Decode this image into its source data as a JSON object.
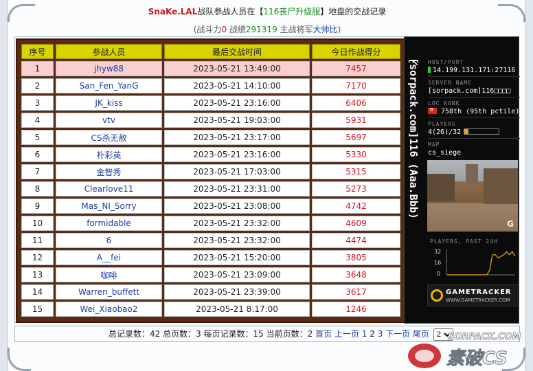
{
  "header": {
    "team": "SnaKe.LAL",
    "text1": "战队参战人员在【",
    "server": "116丧尸升级服",
    "text2": "】地盘的交战记录"
  },
  "stats": {
    "open": "(战斗力",
    "power": "0",
    "label_record": " 战绩",
    "record": "291319",
    "label_leader": " 主战将军",
    "leader": "大帅比",
    "close": ")"
  },
  "table": {
    "headers": [
      "序号",
      "参战人员",
      "最后交战时间",
      "今日作战得分"
    ],
    "rows": [
      {
        "no": "1",
        "name": "jhyw88",
        "time": "2023-05-21 13:49:00",
        "score": "7457"
      },
      {
        "no": "2",
        "name": "San_Fen_YanG",
        "time": "2023-05-21 14:10:00",
        "score": "7170"
      },
      {
        "no": "3",
        "name": "JK_kiss",
        "time": "2023-05-21 23:16:00",
        "score": "6406"
      },
      {
        "no": "4",
        "name": "vtv",
        "time": "2023-05-21 19:03:00",
        "score": "5931"
      },
      {
        "no": "5",
        "name": "CS杀无赦",
        "time": "2023-05-21 23:17:00",
        "score": "5697"
      },
      {
        "no": "6",
        "name": "朴彩英",
        "time": "2023-05-21 23:16:00",
        "score": "5330"
      },
      {
        "no": "7",
        "name": "金智秀",
        "time": "2023-05-21 17:03:00",
        "score": "5315"
      },
      {
        "no": "8",
        "name": "Clearlove11",
        "time": "2023-05-21 23:31:00",
        "score": "5273"
      },
      {
        "no": "9",
        "name": "Mas_NI_Sorry",
        "time": "2023-05-21 23:08:00",
        "score": "4742"
      },
      {
        "no": "10",
        "name": "formidable",
        "time": "2023-05-21 23:32:00",
        "score": "4609"
      },
      {
        "no": "11",
        "name": "6",
        "time": "2023-05-21 23:32:00",
        "score": "4474"
      },
      {
        "no": "12",
        "name": "A__fei",
        "time": "2023-05-21 15:20:00",
        "score": "3805"
      },
      {
        "no": "13",
        "name": "咖啡",
        "time": "2023-05-21 23:09:00",
        "score": "3648"
      },
      {
        "no": "14",
        "name": "Warren_buffett",
        "time": "2023-05-21 23:39:00",
        "score": "3617"
      },
      {
        "no": "15",
        "name": "Wei_Xiaobao2",
        "time": "2023-05-21 8:17:00",
        "score": "1246"
      }
    ]
  },
  "pager": {
    "summary": "总记录数：42 总页数：3 每页记录数：15 当前页数：2 ",
    "first": "首页",
    "prev": "上一页",
    "p1": "1",
    "p2": "2",
    "p3": "3",
    "next": "下一页",
    "last": "尾页",
    "selected": "2"
  },
  "tracker": {
    "vertical_name": "[sorpack.com]116 (Aaa.Bbb)",
    "host_label": "HOST/PORT",
    "host": "14.199.131.171:27116",
    "server_label": "SERVER NAME",
    "server": "[sorpack.com]116□□□□",
    "loc_label": "LOC  RANK",
    "rank": "758th (95th pctile)",
    "players_label": "PLAYERS",
    "players": "4(26)/32",
    "players_fill": 0.125,
    "map_label": "MAP",
    "map": "cs_siege",
    "chart_label": "PLAYERS, PAST 24H",
    "gt_name": "GAMETRACKER",
    "gt_url": "WWW.GAMETRACKER.COM"
  },
  "chart_data": {
    "type": "line",
    "title": "PLAYERS, PAST 24H",
    "ylim": [
      0,
      32
    ],
    "yticks": [
      "32",
      "16",
      "0"
    ],
    "values": [
      0,
      0,
      0,
      0,
      0,
      0,
      0,
      0,
      0,
      0,
      0,
      0,
      0,
      0,
      0,
      6,
      26,
      26,
      22,
      24,
      26,
      30,
      26,
      30,
      24
    ]
  },
  "colors": {
    "team": "#d0161a",
    "server": "#139018",
    "header_bg": "#d9d400",
    "table_border": "#5a2a12",
    "name_link": "#1a3fa8",
    "score": "#d0161a"
  },
  "watermark": {
    "site": "SORPACK.COM",
    "brand": "素破CS"
  }
}
